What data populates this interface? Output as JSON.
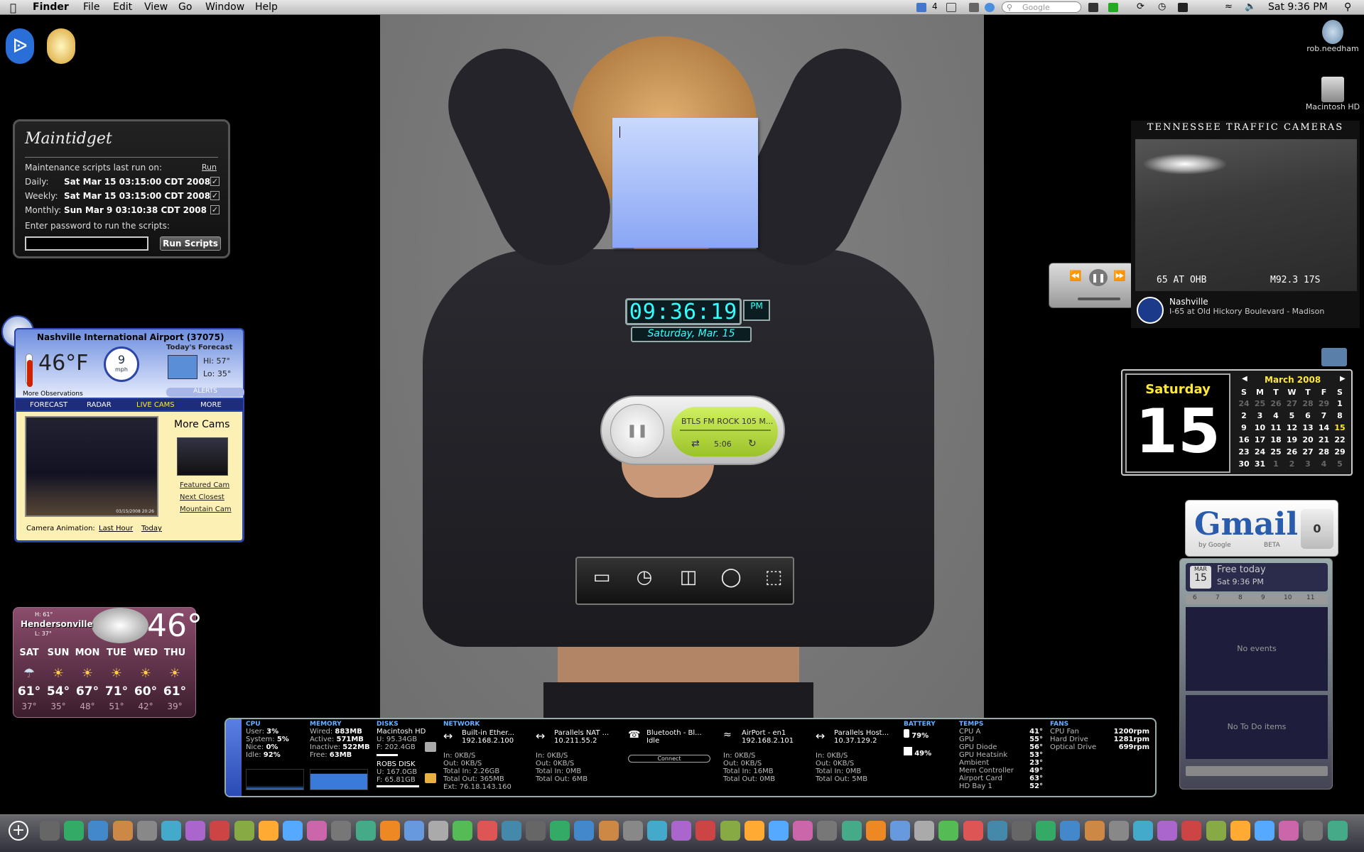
{
  "menubar": {
    "apple": "",
    "app": "Finder",
    "items": [
      "File",
      "Edit",
      "View",
      "Go",
      "Window",
      "Help"
    ],
    "cal_count": "4",
    "search_placeholder": "Google",
    "clock": "Sat 9:36 PM"
  },
  "desktop": {
    "user": "rob.needham",
    "disk": "Macintosh HD"
  },
  "maintidget": {
    "title": "Maintidget",
    "last_run_label": "Maintenance scripts last run on:",
    "run_link": "Run",
    "rows": [
      {
        "label": "Daily:",
        "value": "Sat Mar 15 03:15:00 CDT 2008"
      },
      {
        "label": "Weekly:",
        "value": "Sat Mar 15 03:15:00 CDT 2008"
      },
      {
        "label": "Monthly:",
        "value": "Sun Mar 9 03:10:38 CDT 2008"
      }
    ],
    "password_label": "Enter password to run the scripts:",
    "run_button": "Run Scripts"
  },
  "weather_widget": {
    "location": "Nashville International Airport (37075)",
    "temp": "46°F",
    "wind_speed": "9",
    "wind_unit": "mph",
    "forecast_label": "Today's Forecast",
    "hi": "Hi: 57°",
    "lo": "Lo: 35°",
    "alerts": "ALERTS",
    "more_obs": "More Observations",
    "tabs": [
      "FORECAST",
      "RADAR",
      "LIVE CAMS",
      "MORE"
    ],
    "more_cams": "More Cams",
    "links": [
      "Featured Cam",
      "Next Closest",
      "Mountain Cam"
    ],
    "animation_label": "Camera Animation:",
    "anim_links": [
      "Last Hour",
      "Today"
    ],
    "cam_stamp": "03/15/2008 20:26"
  },
  "weather_small": {
    "city": "Hendersonville",
    "hi": "H: 61°",
    "lo": "L: 37°",
    "current": "46°",
    "days": [
      {
        "day": "SAT",
        "hi": "61°",
        "lo": "37°"
      },
      {
        "day": "SUN",
        "hi": "54°",
        "lo": "35°"
      },
      {
        "day": "MON",
        "hi": "67°",
        "lo": "48°"
      },
      {
        "day": "TUE",
        "hi": "71°",
        "lo": "51°"
      },
      {
        "day": "WED",
        "hi": "60°",
        "lo": "42°"
      },
      {
        "day": "THU",
        "hi": "61°",
        "lo": "39°"
      }
    ]
  },
  "clock_widget": {
    "time": "09:36:19",
    "ampm": "PM",
    "date": "Saturday, Mar. 15"
  },
  "music_widget": {
    "station": "BTLS FM ROCK 105 M...",
    "elapsed": "5:06"
  },
  "traffic": {
    "title": "TENNESSEE TRAFFIC CAMERAS",
    "overlay_left": "65 AT OHB",
    "overlay_right": "M92.3 17S",
    "city": "Nashville",
    "location": "I-65 at Old Hickory Boulevard - Madison"
  },
  "calendar": {
    "weekday": "Saturday",
    "day": "15",
    "month": "March 2008",
    "headers": [
      "S",
      "M",
      "T",
      "W",
      "T",
      "F",
      "S"
    ],
    "weeks": [
      [
        "24",
        "25",
        "26",
        "27",
        "28",
        "29",
        "1"
      ],
      [
        "2",
        "3",
        "4",
        "5",
        "6",
        "7",
        "8"
      ],
      [
        "9",
        "10",
        "11",
        "12",
        "13",
        "14",
        "15"
      ],
      [
        "16",
        "17",
        "18",
        "19",
        "20",
        "21",
        "22"
      ],
      [
        "23",
        "24",
        "25",
        "26",
        "27",
        "28",
        "29"
      ],
      [
        "30",
        "31",
        "1",
        "2",
        "3",
        "4",
        "5"
      ]
    ]
  },
  "gmail": {
    "logo": "Gmail",
    "by": "by Google",
    "beta": "BETA",
    "count": "0"
  },
  "ical": {
    "month_abbr": "MAR",
    "day": "15",
    "status": "Free today",
    "time": "Sat 9:36 PM",
    "hours": [
      "6",
      "7",
      "8",
      "9",
      "10",
      "11"
    ],
    "no_events": "No events",
    "no_todos": "No To Do items"
  },
  "istat": {
    "cpu": {
      "title": "CPU",
      "user": "3%",
      "system": "5%",
      "nice": "0%",
      "idle": "92%"
    },
    "memory": {
      "title": "MEMORY",
      "wired": "883MB",
      "active": "571MB",
      "inactive": "522MB",
      "free": "63MB"
    },
    "disks": {
      "title": "DISKS",
      "d1": "Macintosh HD",
      "d1u": "U: 95.34GB",
      "d1f": "F: 202.4GB",
      "d2": "ROBS DISK",
      "d2u": "U: 167.0GB",
      "d2f": "F: 65.81GB"
    },
    "network": {
      "title": "NETWORK",
      "ifaces": [
        {
          "name": "Built-in Ether...",
          "ip": "192.168.2.100",
          "in": "In: 0KB/S",
          "out": "Out: 0KB/S",
          "tin": "Total In: 2.26GB",
          "tout": "Total Out: 365MB",
          "ext": "Ext: 76.18.143.160"
        },
        {
          "name": "Parallels NAT ...",
          "ip": "10.211.55.2",
          "in": "In: 0KB/S",
          "out": "Out: 0KB/S",
          "tin": "Total In: 0MB",
          "tout": "Total Out: 6MB",
          "ext": ""
        },
        {
          "name": "Bluetooth - Bl...",
          "ip": "Idle",
          "in": "",
          "out": "",
          "tin": "",
          "tout": "",
          "ext": ""
        },
        {
          "name": "AirPort - en1",
          "ip": "192.168.2.101",
          "in": "In: 0KB/S",
          "out": "Out: 0KB/S",
          "tin": "Total In: 16MB",
          "tout": "Total Out: 0MB",
          "ext": ""
        },
        {
          "name": "Parallels Host...",
          "ip": "10.37.129.2",
          "in": "In: 0KB/S",
          "out": "Out: 0KB/S",
          "tin": "Total In: 0MB",
          "tout": "Total Out: 5MB",
          "ext": ""
        }
      ],
      "connect": "Connect"
    },
    "battery": {
      "title": "BATTERY",
      "b1": "79%",
      "b2": "49%"
    },
    "temps": {
      "title": "TEMPS",
      "items": [
        {
          "n": "CPU A",
          "v": "41°"
        },
        {
          "n": "GPU",
          "v": "55°"
        },
        {
          "n": "GPU Diode",
          "v": "56°"
        },
        {
          "n": "GPU Heatsink",
          "v": "53°"
        },
        {
          "n": "Ambient",
          "v": "23°"
        },
        {
          "n": "Mem Controller",
          "v": "49°"
        },
        {
          "n": "Airport Card",
          "v": "63°"
        },
        {
          "n": "HD Bay 1",
          "v": "52°"
        }
      ]
    },
    "fans": {
      "title": "FANS",
      "items": [
        {
          "n": "CPU Fan",
          "v": "1200rpm"
        },
        {
          "n": "Hard Drive",
          "v": "1281rpm"
        },
        {
          "n": "Optical Drive",
          "v": "699rpm"
        }
      ]
    }
  }
}
